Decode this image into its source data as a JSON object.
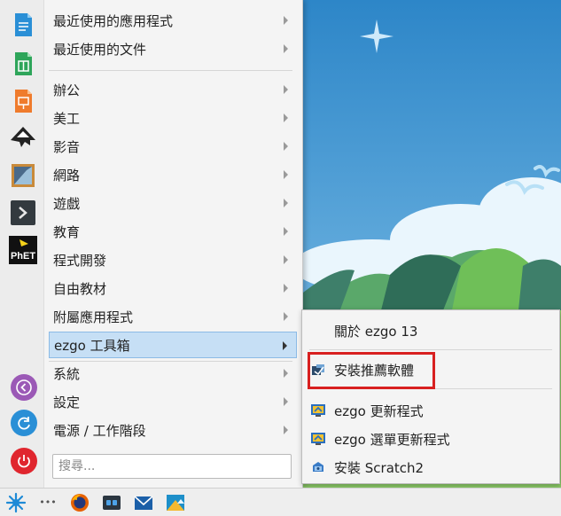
{
  "menu": {
    "categories": [
      {
        "label": "最近使用的應用程式",
        "has_arrow": true
      },
      {
        "label": "最近使用的文件",
        "has_arrow": true
      },
      {
        "label": "辦公",
        "has_arrow": true
      },
      {
        "label": "美工",
        "has_arrow": true
      },
      {
        "label": "影音",
        "has_arrow": true
      },
      {
        "label": "網路",
        "has_arrow": true
      },
      {
        "label": "遊戲",
        "has_arrow": true
      },
      {
        "label": "教育",
        "has_arrow": true
      },
      {
        "label": "程式開發",
        "has_arrow": true
      },
      {
        "label": "自由教材",
        "has_arrow": true
      },
      {
        "label": "附屬應用程式",
        "has_arrow": true
      },
      {
        "label": "ezgo 工具箱",
        "has_arrow": true,
        "active": true
      },
      {
        "label": "系統",
        "has_arrow": true
      },
      {
        "label": "設定",
        "has_arrow": true
      },
      {
        "label": "電源 / 工作階段",
        "has_arrow": true
      }
    ],
    "search_placeholder": "搜尋...",
    "favorites": [
      "document-writer-icon",
      "spreadsheet-icon",
      "presentation-icon",
      "inkscape-icon",
      "image-viewer-icon",
      "terminal-icon",
      "phet-icon"
    ],
    "phet_text": "PhET",
    "system_buttons": [
      "back-icon",
      "refresh-icon",
      "power-icon"
    ]
  },
  "submenu": {
    "items": [
      {
        "label": "關於 ezgo 13",
        "icon": "none"
      },
      {
        "label": "安裝推薦軟體",
        "icon": "install-package-icon"
      },
      {
        "label": "ezgo 更新程式",
        "icon": "update-icon"
      },
      {
        "label": "ezgo 選單更新程式",
        "icon": "update-icon"
      },
      {
        "label": "安裝 Scratch2",
        "icon": "scratch-icon"
      }
    ]
  },
  "taskbar": {
    "items": [
      "ezgo-launcher-icon",
      "more-icon",
      "firefox-icon",
      "task-manager-icon",
      "mail-icon",
      "image-editor-icon"
    ],
    "more_text": "•••"
  },
  "colors": {
    "active_row": "#c6dff5",
    "highlight_box": "#d82020",
    "sky": "#4f9fd6"
  }
}
